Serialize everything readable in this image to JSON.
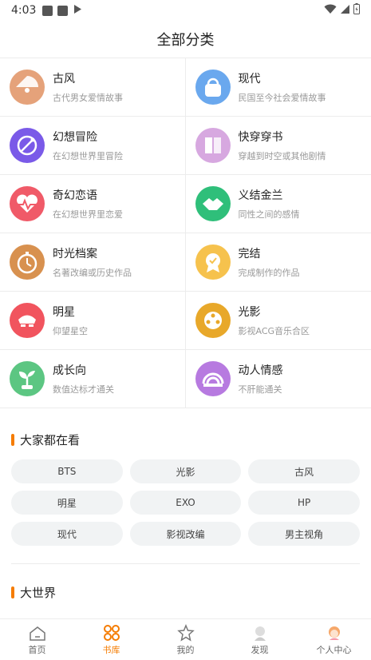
{
  "status": {
    "time": "4:03"
  },
  "header": {
    "title": "全部分类"
  },
  "categories": [
    {
      "name": "古风",
      "desc": "古代男女爱情故事",
      "icon": "fan-icon",
      "color": "#e5a27a"
    },
    {
      "name": "现代",
      "desc": "民国至今社会爱情故事",
      "icon": "handbag-icon",
      "color": "#6aa8ee"
    },
    {
      "name": "幻想冒险",
      "desc": "在幻想世界里冒险",
      "icon": "magic-compass-icon",
      "color": "#7a5ae8"
    },
    {
      "name": "快穿穿书",
      "desc": "穿越到时空或其他剧情",
      "icon": "book-icon",
      "color": "#d7a8e0"
    },
    {
      "name": "奇幻恋语",
      "desc": "在幻想世界里恋爱",
      "icon": "heart-pulse-icon",
      "color": "#f05a68"
    },
    {
      "name": "义结金兰",
      "desc": "同性之间的感情",
      "icon": "handshake-icon",
      "color": "#2fbf7a"
    },
    {
      "name": "时光档案",
      "desc": "名著改编或历史作品",
      "icon": "pocket-watch-icon",
      "color": "#d8914f"
    },
    {
      "name": "完结",
      "desc": "完成制作的作品",
      "icon": "medal-icon",
      "color": "#f6c24d"
    },
    {
      "name": "明星",
      "desc": "仰望星空",
      "icon": "star-face-icon",
      "color": "#f1545e"
    },
    {
      "name": "光影",
      "desc": "影视ACG音乐合区",
      "icon": "film-reel-icon",
      "color": "#e8a82a"
    },
    {
      "name": "成长向",
      "desc": "数值达标才通关",
      "icon": "sprout-icon",
      "color": "#5cc682"
    },
    {
      "name": "动人情感",
      "desc": "不肝能通关",
      "icon": "rainbow-icon",
      "color": "#b77ae0"
    }
  ],
  "popular": {
    "title": "大家都在看",
    "tags": [
      "BTS",
      "光影",
      "古风",
      "明星",
      "EXO",
      "HP",
      "现代",
      "影视改编",
      "男主视角"
    ]
  },
  "world": {
    "title": "大世界"
  },
  "tabbar": {
    "items": [
      {
        "label": "首页",
        "icon": "home-icon"
      },
      {
        "label": "书库",
        "icon": "library-icon"
      },
      {
        "label": "我的",
        "icon": "my-icon"
      },
      {
        "label": "发现",
        "icon": "discover-icon"
      },
      {
        "label": "个人中心",
        "icon": "profile-icon"
      }
    ],
    "active": "书库",
    "active_color": "#f57c00"
  }
}
